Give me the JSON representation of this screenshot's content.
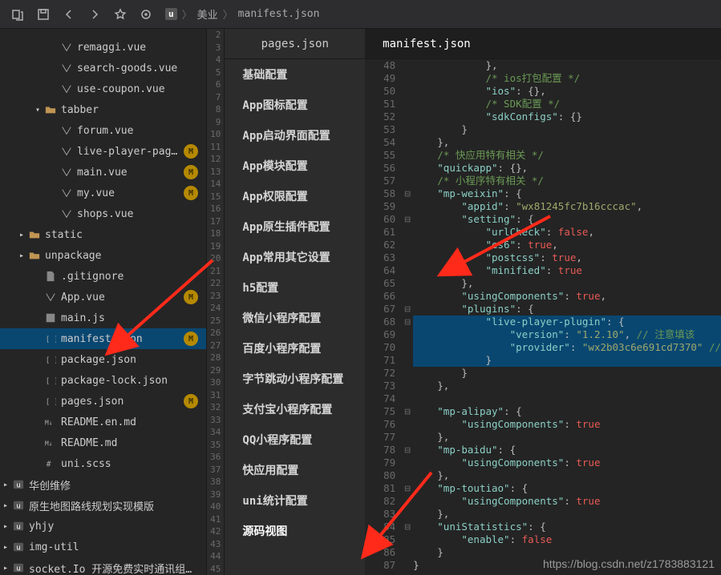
{
  "breadcrumb": {
    "app_icon": "u",
    "seg1": "美业",
    "seg2": "manifest.json"
  },
  "tabs": {
    "mid": "pages.json",
    "code": "manifest.json"
  },
  "watermark": "https://blog.csdn.net/z1783883121",
  "tree": [
    {
      "indent": 3,
      "icon": "vue",
      "label": "remaggi.vue"
    },
    {
      "indent": 3,
      "icon": "vue",
      "label": "search-goods.vue"
    },
    {
      "indent": 3,
      "icon": "vue",
      "label": "use-coupon.vue"
    },
    {
      "indent": 2,
      "chevron": "v",
      "icon": "folder",
      "label": "tabber"
    },
    {
      "indent": 3,
      "icon": "vue",
      "label": "forum.vue"
    },
    {
      "indent": 3,
      "icon": "vue",
      "label": "live-player-page.vue",
      "status": "M"
    },
    {
      "indent": 3,
      "icon": "vue",
      "label": "main.vue",
      "status": "M"
    },
    {
      "indent": 3,
      "icon": "vue",
      "label": "my.vue",
      "status": "M"
    },
    {
      "indent": 3,
      "icon": "vue",
      "label": "shops.vue"
    },
    {
      "indent": 1,
      "chevron": ">",
      "icon": "folder",
      "label": "static"
    },
    {
      "indent": 1,
      "chevron": ">",
      "icon": "folder",
      "label": "unpackage"
    },
    {
      "indent": 2,
      "icon": "file",
      "label": ".gitignore"
    },
    {
      "indent": 2,
      "icon": "vue",
      "label": "App.vue",
      "status": "M"
    },
    {
      "indent": 2,
      "icon": "js",
      "label": "main.js"
    },
    {
      "indent": 2,
      "icon": "json",
      "label": "manifest.json",
      "active": true,
      "status": "M"
    },
    {
      "indent": 2,
      "icon": "json",
      "label": "package.json"
    },
    {
      "indent": 2,
      "icon": "json",
      "label": "package-lock.json"
    },
    {
      "indent": 2,
      "icon": "json",
      "label": "pages.json",
      "status": "M"
    },
    {
      "indent": 2,
      "icon": "md",
      "label": "README.en.md"
    },
    {
      "indent": 2,
      "icon": "md",
      "label": "README.md"
    },
    {
      "indent": 2,
      "icon": "scss",
      "label": "uni.scss"
    },
    {
      "indent": 0,
      "chevron": ">",
      "icon": "u",
      "label": "华创维修"
    },
    {
      "indent": 0,
      "chevron": ">",
      "icon": "u",
      "label": "原生地图路线规划实现模版"
    },
    {
      "indent": 0,
      "chevron": ">",
      "icon": "u",
      "label": "yhjy"
    },
    {
      "indent": 0,
      "chevron": ">",
      "icon": "u",
      "label": "img-util"
    },
    {
      "indent": 0,
      "chevron": ">",
      "icon": "u",
      "label": "socket.Io 开源免费实时通讯组件示例"
    }
  ],
  "nav_items": [
    "基础配置",
    "App图标配置",
    "App启动界面配置",
    "App模块配置",
    "App权限配置",
    "App原生插件配置",
    "App常用其它设置",
    "h5配置",
    "微信小程序配置",
    "百度小程序配置",
    "字节跳动小程序配置",
    "支付宝小程序配置",
    "QQ小程序配置",
    "快应用配置",
    "uni统计配置",
    "源码视图"
  ],
  "left_gutter_start": 2,
  "left_gutter_end": 45,
  "chart_data": {
    "type": "table",
    "title": "manifest.json (excerpt)",
    "rows": [
      {
        "line": 48,
        "frag": [
          {
            "t": "            },",
            "c": "c-pun"
          }
        ]
      },
      {
        "line": 49,
        "frag": [
          {
            "t": "            ",
            "c": "c-pun"
          },
          {
            "t": "/* ios打包配置 */",
            "c": "c-cmt"
          }
        ]
      },
      {
        "line": 50,
        "frag": [
          {
            "t": "            ",
            "c": "c-pun"
          },
          {
            "t": "\"ios\"",
            "c": "c-key"
          },
          {
            "t": ": {},",
            "c": "c-pun"
          }
        ]
      },
      {
        "line": 51,
        "frag": [
          {
            "t": "            ",
            "c": "c-pun"
          },
          {
            "t": "/* SDK配置 */",
            "c": "c-cmt"
          }
        ]
      },
      {
        "line": 52,
        "frag": [
          {
            "t": "            ",
            "c": "c-pun"
          },
          {
            "t": "\"sdkConfigs\"",
            "c": "c-key"
          },
          {
            "t": ": {}",
            "c": "c-pun"
          }
        ]
      },
      {
        "line": 53,
        "frag": [
          {
            "t": "        }",
            "c": "c-pun"
          }
        ]
      },
      {
        "line": 54,
        "frag": [
          {
            "t": "    },",
            "c": "c-pun"
          }
        ]
      },
      {
        "line": 55,
        "frag": [
          {
            "t": "    ",
            "c": "c-pun"
          },
          {
            "t": "/* 快应用特有相关 */",
            "c": "c-cmt"
          }
        ]
      },
      {
        "line": 56,
        "frag": [
          {
            "t": "    ",
            "c": "c-pun"
          },
          {
            "t": "\"quickapp\"",
            "c": "c-key"
          },
          {
            "t": ": {},",
            "c": "c-pun"
          }
        ]
      },
      {
        "line": 57,
        "frag": [
          {
            "t": "    ",
            "c": "c-pun"
          },
          {
            "t": "/* 小程序特有相关 */",
            "c": "c-cmt"
          }
        ]
      },
      {
        "line": 58,
        "fold": "-",
        "frag": [
          {
            "t": "    ",
            "c": "c-pun"
          },
          {
            "t": "\"mp-weixin\"",
            "c": "c-key"
          },
          {
            "t": ": {",
            "c": "c-pun"
          }
        ]
      },
      {
        "line": 59,
        "frag": [
          {
            "t": "        ",
            "c": "c-pun"
          },
          {
            "t": "\"appid\"",
            "c": "c-key"
          },
          {
            "t": ": ",
            "c": "c-pun"
          },
          {
            "t": "\"wx81245fc7b16cccac\"",
            "c": "c-str"
          },
          {
            "t": ",",
            "c": "c-pun"
          }
        ]
      },
      {
        "line": 60,
        "fold": "-",
        "frag": [
          {
            "t": "        ",
            "c": "c-pun"
          },
          {
            "t": "\"setting\"",
            "c": "c-key"
          },
          {
            "t": ": {",
            "c": "c-pun"
          }
        ]
      },
      {
        "line": 61,
        "frag": [
          {
            "t": "            ",
            "c": "c-pun"
          },
          {
            "t": "\"urlCheck\"",
            "c": "c-key"
          },
          {
            "t": ": ",
            "c": "c-pun"
          },
          {
            "t": "false",
            "c": "c-bool"
          },
          {
            "t": ",",
            "c": "c-pun"
          }
        ]
      },
      {
        "line": 62,
        "frag": [
          {
            "t": "            ",
            "c": "c-pun"
          },
          {
            "t": "\"es6\"",
            "c": "c-key"
          },
          {
            "t": ": ",
            "c": "c-pun"
          },
          {
            "t": "true",
            "c": "c-bool"
          },
          {
            "t": ",",
            "c": "c-pun"
          }
        ]
      },
      {
        "line": 63,
        "frag": [
          {
            "t": "            ",
            "c": "c-pun"
          },
          {
            "t": "\"postcss\"",
            "c": "c-key"
          },
          {
            "t": ": ",
            "c": "c-pun"
          },
          {
            "t": "true",
            "c": "c-bool"
          },
          {
            "t": ",",
            "c": "c-pun"
          }
        ]
      },
      {
        "line": 64,
        "frag": [
          {
            "t": "            ",
            "c": "c-pun"
          },
          {
            "t": "\"minified\"",
            "c": "c-key"
          },
          {
            "t": ": ",
            "c": "c-pun"
          },
          {
            "t": "true",
            "c": "c-bool"
          }
        ]
      },
      {
        "line": 65,
        "frag": [
          {
            "t": "        },",
            "c": "c-pun"
          }
        ]
      },
      {
        "line": 66,
        "frag": [
          {
            "t": "        ",
            "c": "c-pun"
          },
          {
            "t": "\"usingComponents\"",
            "c": "c-key"
          },
          {
            "t": ": ",
            "c": "c-pun"
          },
          {
            "t": "true",
            "c": "c-bool"
          },
          {
            "t": ",",
            "c": "c-pun"
          }
        ]
      },
      {
        "line": 67,
        "fold": "-",
        "frag": [
          {
            "t": "        ",
            "c": "c-pun"
          },
          {
            "t": "\"plugins\"",
            "c": "c-key"
          },
          {
            "t": ": {",
            "c": "c-pun"
          }
        ]
      },
      {
        "line": 68,
        "sel": true,
        "fold": "-",
        "frag": [
          {
            "t": "            ",
            "c": "c-pun"
          },
          {
            "t": "\"live-player-plugin\"",
            "c": "c-key"
          },
          {
            "t": ": {",
            "c": "c-pun"
          }
        ]
      },
      {
        "line": 69,
        "sel": true,
        "frag": [
          {
            "t": "                ",
            "c": "c-pun"
          },
          {
            "t": "\"version\"",
            "c": "c-key"
          },
          {
            "t": ": ",
            "c": "c-pun"
          },
          {
            "t": "\"1.2.10\"",
            "c": "c-str"
          },
          {
            "t": ", ",
            "c": "c-pun"
          },
          {
            "t": "// 注意填该",
            "c": "c-cmt"
          }
        ]
      },
      {
        "line": 70,
        "sel": true,
        "frag": [
          {
            "t": "                ",
            "c": "c-pun"
          },
          {
            "t": "\"provider\"",
            "c": "c-key"
          },
          {
            "t": ": ",
            "c": "c-pun"
          },
          {
            "t": "\"wx2b03c6e691cd7370\"",
            "c": "c-str"
          },
          {
            "t": " //",
            "c": "c-cmt"
          }
        ]
      },
      {
        "line": 71,
        "sel": true,
        "frag": [
          {
            "t": "            }",
            "c": "c-pun"
          }
        ]
      },
      {
        "line": 72,
        "frag": [
          {
            "t": "        }",
            "c": "c-pun"
          }
        ]
      },
      {
        "line": 73,
        "frag": [
          {
            "t": "    },",
            "c": "c-pun"
          }
        ]
      },
      {
        "line": 74,
        "frag": [
          {
            "t": "",
            "c": ""
          }
        ]
      },
      {
        "line": 75,
        "fold": "-",
        "frag": [
          {
            "t": "    ",
            "c": "c-pun"
          },
          {
            "t": "\"mp-alipay\"",
            "c": "c-key"
          },
          {
            "t": ": {",
            "c": "c-pun"
          }
        ]
      },
      {
        "line": 76,
        "frag": [
          {
            "t": "        ",
            "c": "c-pun"
          },
          {
            "t": "\"usingComponents\"",
            "c": "c-key"
          },
          {
            "t": ": ",
            "c": "c-pun"
          },
          {
            "t": "true",
            "c": "c-bool"
          }
        ]
      },
      {
        "line": 77,
        "frag": [
          {
            "t": "    },",
            "c": "c-pun"
          }
        ]
      },
      {
        "line": 78,
        "fold": "-",
        "frag": [
          {
            "t": "    ",
            "c": "c-pun"
          },
          {
            "t": "\"mp-baidu\"",
            "c": "c-key"
          },
          {
            "t": ": {",
            "c": "c-pun"
          }
        ]
      },
      {
        "line": 79,
        "frag": [
          {
            "t": "        ",
            "c": "c-pun"
          },
          {
            "t": "\"usingComponents\"",
            "c": "c-key"
          },
          {
            "t": ": ",
            "c": "c-pun"
          },
          {
            "t": "true",
            "c": "c-bool"
          }
        ]
      },
      {
        "line": 80,
        "frag": [
          {
            "t": "    },",
            "c": "c-pun"
          }
        ]
      },
      {
        "line": 81,
        "fold": "-",
        "frag": [
          {
            "t": "    ",
            "c": "c-pun"
          },
          {
            "t": "\"mp-toutiao\"",
            "c": "c-key"
          },
          {
            "t": ": {",
            "c": "c-pun"
          }
        ]
      },
      {
        "line": 82,
        "frag": [
          {
            "t": "        ",
            "c": "c-pun"
          },
          {
            "t": "\"usingComponents\"",
            "c": "c-key"
          },
          {
            "t": ": ",
            "c": "c-pun"
          },
          {
            "t": "true",
            "c": "c-bool"
          }
        ]
      },
      {
        "line": 83,
        "frag": [
          {
            "t": "    },",
            "c": "c-pun"
          }
        ]
      },
      {
        "line": 84,
        "fold": "-",
        "frag": [
          {
            "t": "    ",
            "c": "c-pun"
          },
          {
            "t": "\"uniStatistics\"",
            "c": "c-key"
          },
          {
            "t": ": {",
            "c": "c-pun"
          }
        ]
      },
      {
        "line": 85,
        "frag": [
          {
            "t": "        ",
            "c": "c-pun"
          },
          {
            "t": "\"enable\"",
            "c": "c-key"
          },
          {
            "t": ": ",
            "c": "c-pun"
          },
          {
            "t": "false",
            "c": "c-bool"
          }
        ]
      },
      {
        "line": 86,
        "frag": [
          {
            "t": "    }",
            "c": "c-pun"
          }
        ]
      },
      {
        "line": 87,
        "frag": [
          {
            "t": "}",
            "c": "c-pun"
          }
        ]
      }
    ]
  }
}
